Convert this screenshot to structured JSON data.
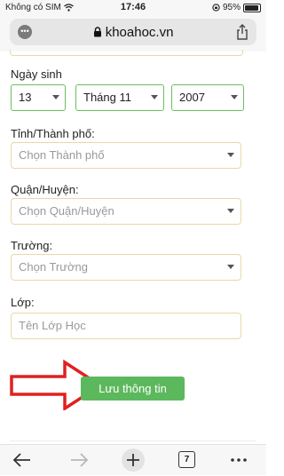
{
  "status_bar": {
    "carrier": "Không có SIM",
    "time": "17:46",
    "battery": "95%",
    "battery_level": 0.95
  },
  "address_bar": {
    "url": "khoahoc.vn",
    "menu_icon": "ellipsis-icon",
    "share_icon": "share-icon"
  },
  "form": {
    "birthday_label": "Ngày sinh",
    "day_value": "13",
    "month_value": "Tháng 11",
    "year_value": "2007",
    "province_label": "Tỉnh/Thành phố:",
    "province_placeholder": "Chọn Thành phố",
    "district_label": "Quận/Huyện:",
    "district_placeholder": "Chọn Quận/Huyện",
    "school_label": "Trường:",
    "school_placeholder": "Chọn Trường",
    "class_label": "Lớp:",
    "class_placeholder": "Tên Lớp Học",
    "save_button": "Lưu thông tin"
  },
  "toolbar": {
    "tab_count": "7"
  },
  "colors": {
    "accent_green": "#5cb85c",
    "field_border": "#e8d8a8",
    "annotation_arrow": "#e02020"
  }
}
